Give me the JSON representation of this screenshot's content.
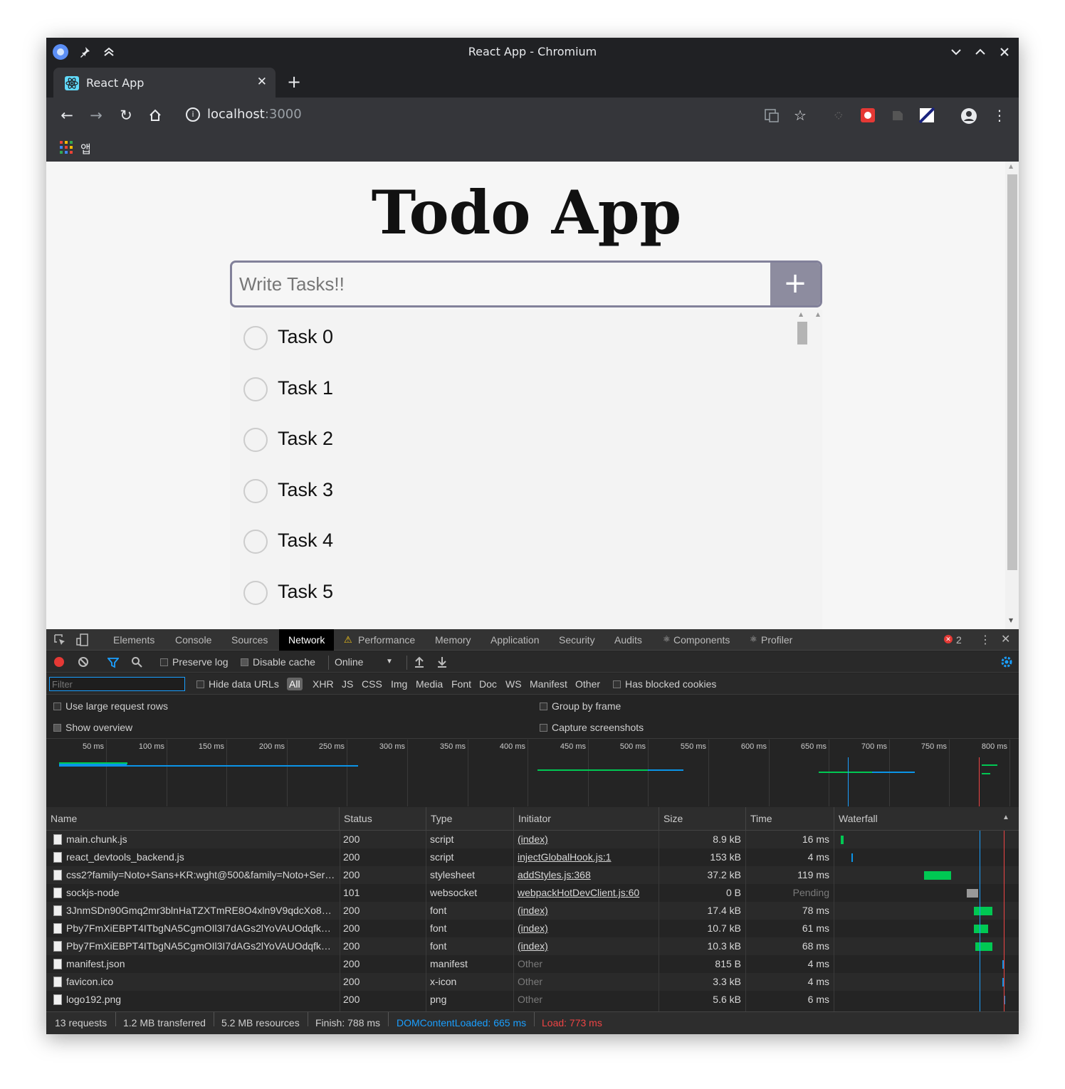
{
  "window": {
    "title": "React App - Chromium"
  },
  "tab": {
    "title": "React App"
  },
  "address": {
    "host": "localhost",
    "port": ":3000"
  },
  "bookmarks": {
    "apps_label": "앱"
  },
  "app": {
    "heading": "Todo App",
    "input_placeholder": "Write Tasks!!",
    "add_label": "+",
    "tasks": [
      "Task 0",
      "Task 1",
      "Task 2",
      "Task 3",
      "Task 4",
      "Task 5"
    ]
  },
  "devtools": {
    "tabs": [
      "Elements",
      "Console",
      "Sources",
      "Network",
      "Performance",
      "Memory",
      "Application",
      "Security",
      "Audits",
      "Components",
      "Profiler"
    ],
    "active_tab": "Network",
    "error_count": "2",
    "toolbar": {
      "preserve_log": "Preserve log",
      "disable_cache": "Disable cache",
      "throttle": "Online"
    },
    "filter": {
      "placeholder": "Filter",
      "hide_data_urls": "Hide data URLs",
      "types": [
        "All",
        "XHR",
        "JS",
        "CSS",
        "Img",
        "Media",
        "Font",
        "Doc",
        "WS",
        "Manifest",
        "Other"
      ],
      "has_blocked_cookies": "Has blocked cookies"
    },
    "options": {
      "large_rows": "Use large request rows",
      "show_overview": "Show overview",
      "group_by_frame": "Group by frame",
      "capture_screenshots": "Capture screenshots"
    },
    "timeline_ticks": [
      "50 ms",
      "100 ms",
      "150 ms",
      "200 ms",
      "250 ms",
      "300 ms",
      "350 ms",
      "400 ms",
      "450 ms",
      "500 ms",
      "550 ms",
      "600 ms",
      "650 ms",
      "700 ms",
      "750 ms",
      "800 ms"
    ],
    "columns": [
      "Name",
      "Status",
      "Type",
      "Initiator",
      "Size",
      "Time",
      "Waterfall"
    ],
    "rows": [
      {
        "name": "main.chunk.js",
        "status": "200",
        "type": "script",
        "initiator": "(index)",
        "initiator_link": true,
        "size": "8.9 kB",
        "time": "16 ms"
      },
      {
        "name": "react_devtools_backend.js",
        "status": "200",
        "type": "script",
        "initiator": "injectGlobalHook.js:1",
        "initiator_link": true,
        "size": "153 kB",
        "time": "4 ms"
      },
      {
        "name": "css2?family=Noto+Sans+KR:wght@500&family=Noto+Ser…",
        "status": "200",
        "type": "stylesheet",
        "initiator": "addStyles.js:368",
        "initiator_link": true,
        "size": "37.2 kB",
        "time": "119 ms"
      },
      {
        "name": "sockjs-node",
        "status": "101",
        "type": "websocket",
        "initiator": "webpackHotDevClient.js:60",
        "initiator_link": true,
        "size": "0 B",
        "time": "Pending"
      },
      {
        "name": "3JnmSDn90Gmq2mr3blnHaTZXTmRE8O4xln9V9qdcXo8…",
        "status": "200",
        "type": "font",
        "initiator": "(index)",
        "initiator_link": true,
        "size": "17.4 kB",
        "time": "78 ms"
      },
      {
        "name": "Pby7FmXiEBPT4ITbgNA5CgmOIl3I7dAGs2lYoVAUOdqfk…",
        "status": "200",
        "type": "font",
        "initiator": "(index)",
        "initiator_link": true,
        "size": "10.7 kB",
        "time": "61 ms"
      },
      {
        "name": "Pby7FmXiEBPT4ITbgNA5CgmOIl3I7dAGs2lYoVAUOdqfk…",
        "status": "200",
        "type": "font",
        "initiator": "(index)",
        "initiator_link": true,
        "size": "10.3 kB",
        "time": "68 ms"
      },
      {
        "name": "manifest.json",
        "status": "200",
        "type": "manifest",
        "initiator": "Other",
        "initiator_link": false,
        "size": "815 B",
        "time": "4 ms"
      },
      {
        "name": "favicon.ico",
        "status": "200",
        "type": "x-icon",
        "initiator": "Other",
        "initiator_link": false,
        "size": "3.3 kB",
        "time": "4 ms"
      },
      {
        "name": "logo192.png",
        "status": "200",
        "type": "png",
        "initiator": "Other",
        "initiator_link": false,
        "size": "5.6 kB",
        "time": "6 ms"
      }
    ],
    "summary": {
      "requests": "13 requests",
      "transferred": "1.2 MB transferred",
      "resources": "5.2 MB resources",
      "finish": "Finish: 788 ms",
      "dom_content_loaded": "DOMContentLoaded: 665 ms",
      "load": "Load: 773 ms"
    }
  },
  "colors": {
    "dcl_blue": "#1a9fff",
    "load_red": "#e44",
    "waterfall_green": "#00c853",
    "waterfall_blue": "#0a94e8"
  }
}
